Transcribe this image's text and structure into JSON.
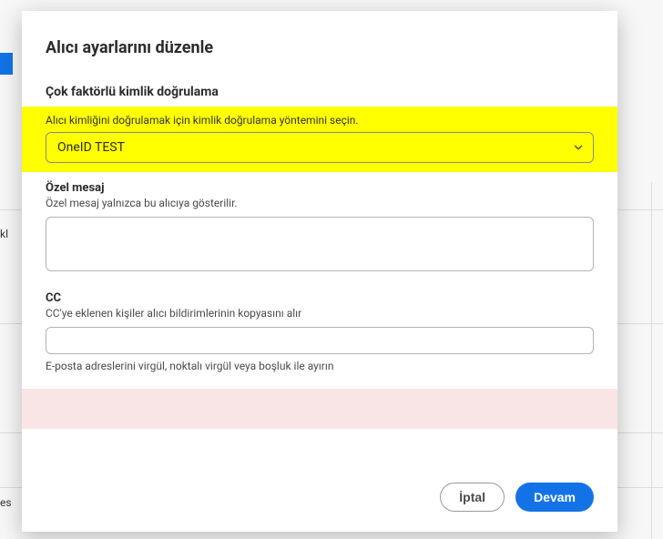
{
  "modal": {
    "title": "Alıcı ayarlarını düzenle",
    "sections": {
      "mfa": {
        "heading": "Çok faktörlü kimlik doğrulama",
        "label": "Alıcı kimliğini doğrulamak için kimlik doğrulama yöntemini seçin.",
        "selected": "OneID TEST"
      },
      "privateMessage": {
        "heading": "Özel mesaj",
        "description": "Özel mesaj yalnızca bu alıcıya gösterilir."
      },
      "cc": {
        "heading": "CC",
        "description": "CC'ye eklenen kişiler alıcı bildirimlerinin kopyasını alır",
        "helper": "E-posta adreslerini virgül, noktalı virgül veya boşluk ile ayırın"
      }
    },
    "actions": {
      "cancel": "İptal",
      "continue": "Devam"
    }
  },
  "bg": {
    "side1": "kl",
    "side2": "es"
  }
}
